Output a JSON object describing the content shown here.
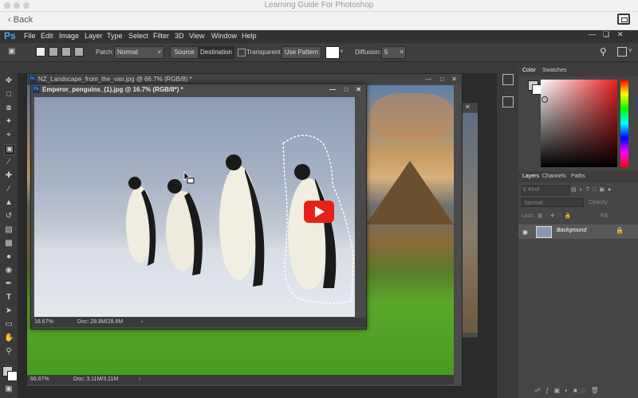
{
  "window": {
    "title": "Learning Guide For Photoshop"
  },
  "nav": {
    "back_label": "Back"
  },
  "menubar": {
    "logo": "Ps",
    "items": [
      "File",
      "Edit",
      "Image",
      "Layer",
      "Type",
      "Select",
      "Filter",
      "3D",
      "View",
      "Window",
      "Help"
    ]
  },
  "options": {
    "patch_label": "Patch:",
    "patch_value": "Normal",
    "source_label": "Source",
    "destination_label": "Destination",
    "transparent_label": "Transparent",
    "use_pattern_label": "Use Pattern",
    "diffusion_label": "Diffusion:",
    "diffusion_value": "5"
  },
  "doc_back": {
    "title": "NZ_Landscape_from_the_van.jpg @ 66.7% (RGB/8) *",
    "zoom": "66.67%",
    "doc_size": "Doc: 3.11M/3.11M"
  },
  "doc_front": {
    "title": "Emperor_penguins_(1).jpg @ 16.7% (RGB/8*) *",
    "zoom": "16.67%",
    "doc_size": "Doc: 28.8M/28.8M"
  },
  "panels": {
    "color_tabs": [
      "Color",
      "Swatches"
    ],
    "layer_tabs": [
      "Layers",
      "Channels",
      "Paths"
    ],
    "kind_label": "Kind",
    "blend_mode": "Normal",
    "opacity_label": "Opacity:",
    "lock_label": "Lock:",
    "fill_label": "Fill:",
    "layer_name": "Background"
  },
  "colors": {
    "ps_blue": "#4aa8ff",
    "youtube_red": "#e62117"
  }
}
